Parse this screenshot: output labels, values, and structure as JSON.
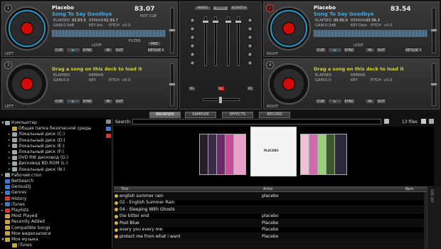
{
  "deck1": {
    "number": "1",
    "artist": "Placebo",
    "song": "Song To Say Goodbye",
    "bpm": "83.07",
    "elapsed_label": "ELAPSED",
    "elapsed_value": "02:03.5",
    "remain_label": "REMAIN",
    "remain_value": "01:33.7",
    "gain_label": "GAIN",
    "gain_value": "0.0dB",
    "key_label": "KEY",
    "key_value": "Am",
    "pitch_label": "PITCH",
    "pitch_value": "+0.0",
    "sync": "SYNC",
    "loop": "LOOP",
    "filter": "FILTER",
    "keylock": "KEYLOCK",
    "shift": "SHIFT",
    "key": "KEY",
    "side": "LEFT",
    "pad": "PAD",
    "mode": "HOT CUE",
    "cue": "CUE",
    "play": "▶",
    "in": "IN",
    "out": "OUT",
    "pitch_bend": "PITCH"
  },
  "deck2": {
    "number": "2",
    "artist": "Placebo",
    "song": "Song To Say Goodbye",
    "bpm": "83.54",
    "elapsed_label": "ELAPSED",
    "elapsed_value": "00:00.0",
    "remain_label": "REMAIN",
    "remain_value": "03:36.3",
    "gain_label": "GAIN",
    "gain_value": "0.0dB",
    "key_label": "KEY",
    "key_value": "Dbm",
    "pitch_label": "PITCH",
    "pitch_value": "+0.0",
    "side": "RIGHT",
    "sync": "SYNC",
    "loop": "LOOP"
  },
  "deck3": {
    "number": "3",
    "hint": "Drag a song on this deck to load it",
    "elapsed_label": "ELAPSED",
    "remain_label": "REMAIN",
    "gain_label": "GAIN",
    "gain_value": "0.0",
    "key_label": "KEY",
    "pitch_label": "PITCH",
    "pitch_value": "+0.0",
    "side": "LEFT"
  },
  "deck4": {
    "number": "4",
    "hint": "Drag a song on this deck to load it",
    "elapsed_label": "ELAPSED",
    "remain_label": "REMAIN",
    "gain_label": "GAIN",
    "gain_value": "0.0",
    "key_label": "KEY",
    "pitch_label": "PITCH",
    "pitch_value": "+0.0",
    "side": "RIGHT"
  },
  "mixer": {
    "tabs": [
      "MIXER",
      "VIDEO",
      "SCRATCH"
    ],
    "active_tab": "VIDEO",
    "pfl": "PFL",
    "rec": "REC"
  },
  "browser_tabs": [
    "BROWSER",
    "SAMPLER",
    "EFFECTS",
    "RECORD"
  ],
  "active_browser_tab": "BROWSER",
  "search": {
    "label": "Search:",
    "value": "",
    "file_count": "13 files"
  },
  "tree": [
    {
      "label": "Компьютер",
      "level": 0,
      "icon": "computer-icon",
      "expander": "▼"
    },
    {
      "label": "Общая папка безопасной среды",
      "level": 1,
      "icon": "folder-icon",
      "expander": ""
    },
    {
      "label": "Локальный диск (C:)",
      "level": 1,
      "icon": "drive-icon",
      "expander": "▸"
    },
    {
      "label": "Локальный диск (D:)",
      "level": 1,
      "icon": "drive-icon",
      "expander": "▸"
    },
    {
      "label": "Локальный диск (E:)",
      "level": 1,
      "icon": "drive-icon",
      "expander": "▸"
    },
    {
      "label": "Локальный диск (F:)",
      "level": 1,
      "icon": "drive-icon",
      "expander": "▸"
    },
    {
      "label": "DVD RW дисковод (G:)",
      "level": 1,
      "icon": "drive-icon",
      "expander": "▸"
    },
    {
      "label": "Дисковод BD-ROM (L:)",
      "level": 1,
      "icon": "drive-icon",
      "expander": "▸"
    },
    {
      "label": "Локальный диск (N:)",
      "level": 1,
      "icon": "drive-icon",
      "expander": "▸"
    },
    {
      "label": "Рабочий стол",
      "level": 0,
      "icon": "desktop-icon",
      "expander": "▸"
    },
    {
      "label": "NetSearch",
      "level": 0,
      "icon": "netsearch-icon",
      "expander": ""
    },
    {
      "label": "GeniusDJ",
      "level": 0,
      "icon": "geniusdj-icon",
      "expander": ""
    },
    {
      "label": "Genres",
      "level": 0,
      "icon": "genres-icon",
      "expander": "▸"
    },
    {
      "label": "History",
      "level": 0,
      "icon": "history-icon",
      "expander": ""
    },
    {
      "label": "iTunes",
      "level": 0,
      "icon": "itunes-icon",
      "expander": "▸"
    },
    {
      "label": "Playlists",
      "level": 0,
      "icon": "playlists-icon",
      "expander": "▸"
    },
    {
      "label": "Most Played",
      "level": 0,
      "icon": "folder-icon",
      "expander": ""
    },
    {
      "label": "Recently Added",
      "level": 0,
      "icon": "folder-icon",
      "expander": ""
    },
    {
      "label": "Compatible Songs",
      "level": 0,
      "icon": "folder-icon",
      "expander": ""
    },
    {
      "label": "Мои видеозаписи",
      "level": 0,
      "icon": "folder-icon",
      "expander": ""
    },
    {
      "label": "Моя музыка",
      "level": 0,
      "icon": "folder-icon",
      "expander": "▼"
    },
    {
      "label": "iTunes",
      "level": 1,
      "icon": "folder-icon",
      "expander": ""
    }
  ],
  "coverflow": {
    "center_label": "PLACEBO"
  },
  "table": {
    "columns": [
      "Title",
      "Artist",
      "Bpm"
    ],
    "rows": [
      {
        "title": "english summer rain",
        "artist": "placebo"
      },
      {
        "title": "02 - English Summer Rain",
        "artist": ""
      },
      {
        "title": "04 - Sleeping With Ghosts",
        "artist": ""
      },
      {
        "title": "the bitter end",
        "artist": "placebo"
      },
      {
        "title": "Post Blue",
        "artist": "Placebo"
      },
      {
        "title": "every you every me",
        "artist": "Placebo"
      },
      {
        "title": "protect me from what i want",
        "artist": "Placebo"
      }
    ]
  },
  "side_list_label": "SIDE LIST",
  "colors": {
    "accent_blue": "#3fa9e0",
    "hint_yellow": "#d6d63a",
    "platter_red": "#d10a0a"
  }
}
